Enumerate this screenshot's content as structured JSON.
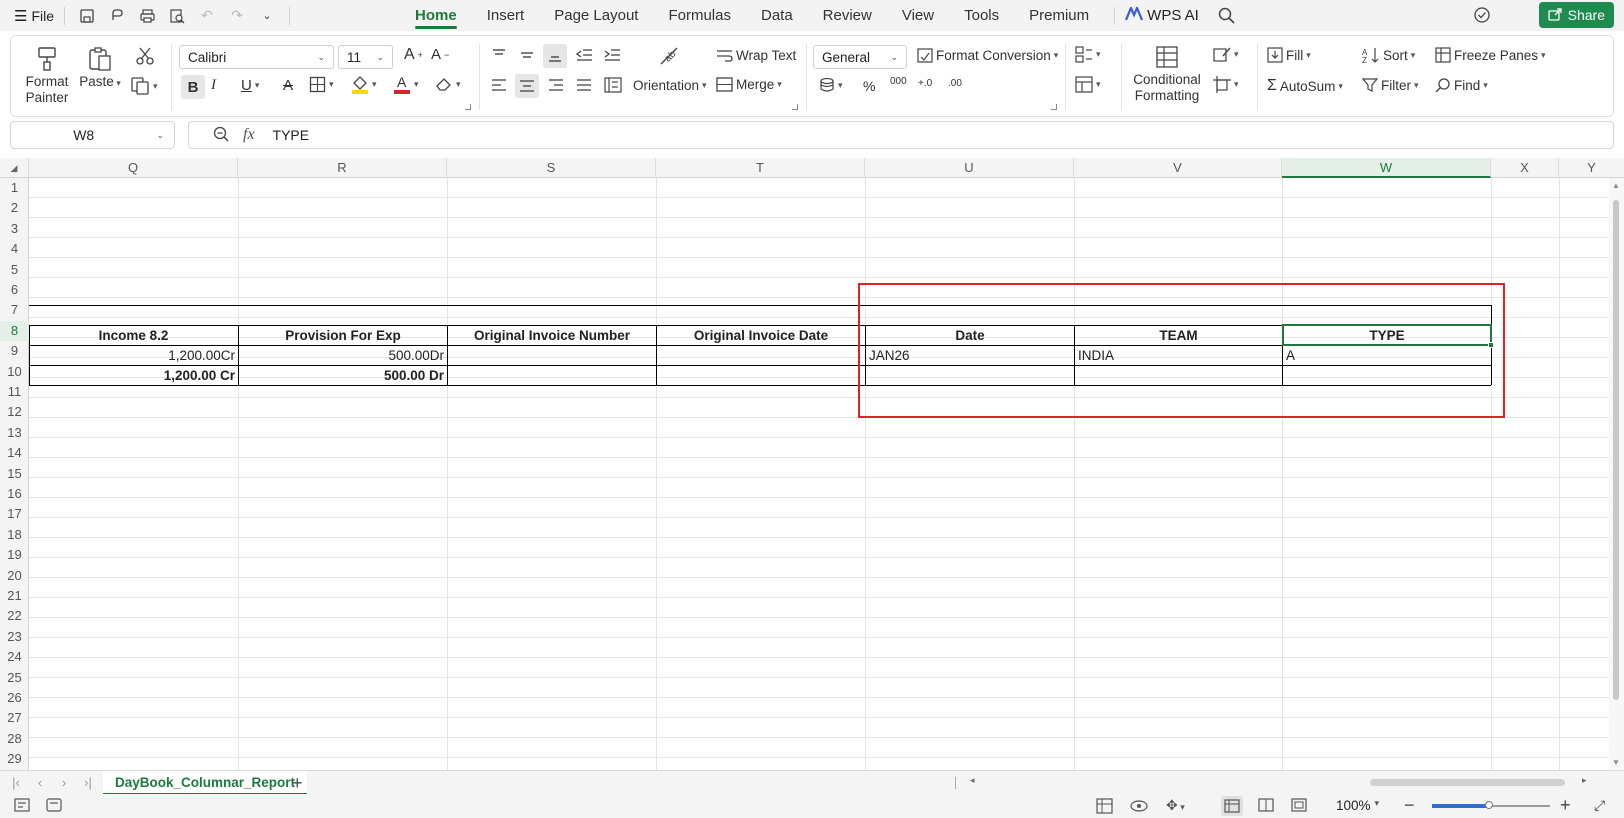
{
  "menubar": {
    "file": "File",
    "tabs": [
      "Home",
      "Insert",
      "Page Layout",
      "Formulas",
      "Data",
      "Review",
      "View",
      "Tools",
      "Premium"
    ],
    "active_tab": "Home",
    "wps_ai": "WPS AI",
    "share": "Share"
  },
  "ribbon": {
    "format_painter": "Format Painter",
    "paste": "Paste",
    "font_name": "Calibri",
    "font_size": "11",
    "wrap_text": "Wrap Text",
    "orientation": "Orientation",
    "merge": "Merge",
    "number_format": "General",
    "format_conversion": "Format Conversion",
    "conditional_formatting": "Conditional Formatting",
    "fill": "Fill",
    "autosum": "AutoSum",
    "sort": "Sort",
    "filter": "Filter",
    "freeze_panes": "Freeze Panes",
    "find": "Find",
    "percent": "%",
    "thousands": "000",
    "dec_inc": "+.0",
    "dec_dec": ".00"
  },
  "formula_bar": {
    "cell_ref": "W8",
    "fx": "fx",
    "content": "TYPE"
  },
  "grid": {
    "columns": [
      "Q",
      "R",
      "S",
      "T",
      "U",
      "V",
      "W",
      "X",
      "Y"
    ],
    "selected_column": "W",
    "rows": [
      "1",
      "2",
      "3",
      "4",
      "5",
      "6",
      "7",
      "8",
      "9",
      "10",
      "11",
      "12",
      "13",
      "14",
      "15",
      "16",
      "17",
      "18",
      "19",
      "20",
      "21",
      "22",
      "23",
      "24",
      "25",
      "26",
      "27",
      "28",
      "29"
    ],
    "selected_row": "8",
    "headers": {
      "q8": "Income 8.2",
      "r8": "Provision For Exp",
      "s8": "Original Invoice Number",
      "t8": "Original Invoice Date",
      "u8": "Date",
      "v8": "TEAM",
      "w8": "TYPE"
    },
    "row9": {
      "q": "1,200.00Cr",
      "r": "500.00Dr",
      "u": "JAN26",
      "v": "INDIA",
      "w": "A"
    },
    "row10": {
      "q": "1,200.00 Cr",
      "r": "500.00 Dr"
    }
  },
  "sheets": {
    "active": "DayBook_Columnar_Report",
    "add": "+"
  },
  "status": {
    "zoom": "100%"
  },
  "colors": {
    "accent": "#1d7a3c",
    "share": "#1e8c4e",
    "highlight": "#e0222b"
  }
}
